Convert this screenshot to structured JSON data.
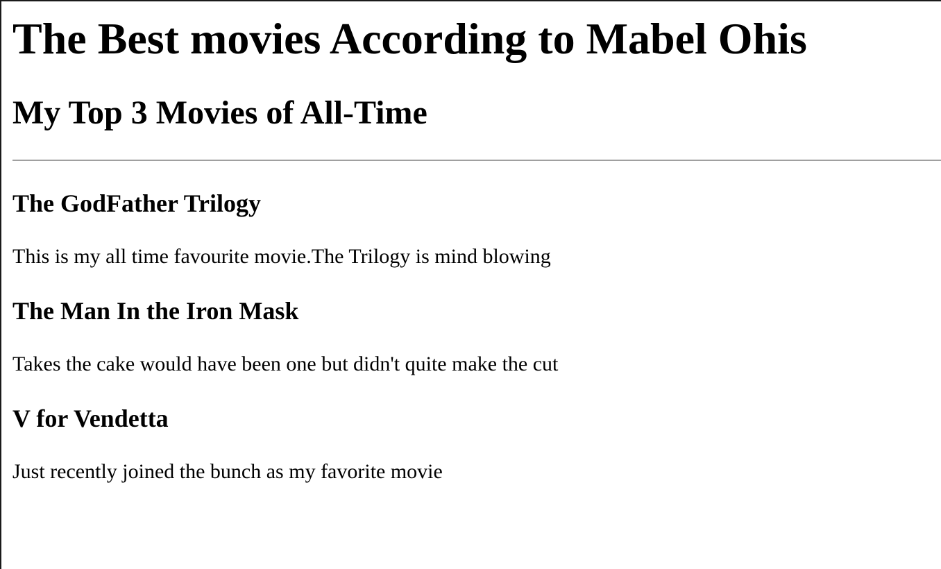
{
  "page": {
    "title": "The Best movies According to Mabel Ohis",
    "subtitle": "My Top 3 Movies of All-Time"
  },
  "movies": [
    {
      "title": "The GodFather Trilogy",
      "description": "This is my all time favourite movie.The Trilogy is mind blowing"
    },
    {
      "title": "The Man In the Iron Mask",
      "description": "Takes the cake would have been one but didn't quite make the cut"
    },
    {
      "title": "V for Vendetta",
      "description": "Just recently joined the bunch as my favorite movie"
    }
  ]
}
